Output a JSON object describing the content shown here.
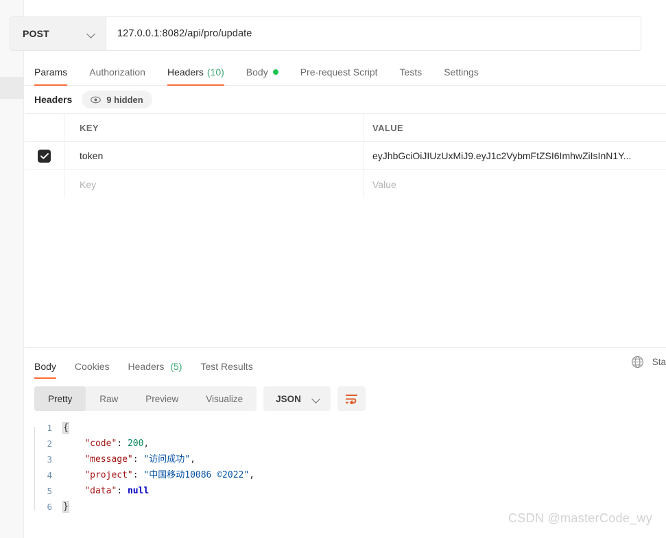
{
  "request": {
    "method": "POST",
    "url": "127.0.0.1:8082/api/pro/update",
    "tabs": [
      {
        "label": "Params",
        "active": false,
        "count": "",
        "dot": false
      },
      {
        "label": "Authorization",
        "active": false,
        "count": "",
        "dot": false
      },
      {
        "label": "Headers",
        "active": true,
        "count": "(10)",
        "dot": false
      },
      {
        "label": "Body",
        "active": false,
        "count": "",
        "dot": true
      },
      {
        "label": "Pre-request Script",
        "active": false,
        "count": "",
        "dot": false
      },
      {
        "label": "Tests",
        "active": false,
        "count": "",
        "dot": false
      },
      {
        "label": "Settings",
        "active": false,
        "count": "",
        "dot": false
      }
    ]
  },
  "headers_panel": {
    "title": "Headers",
    "hidden_badge": "9 hidden",
    "columns": [
      "KEY",
      "VALUE"
    ],
    "rows": [
      {
        "checked": true,
        "key": "token",
        "value": "eyJhbGciOiJIUzUxMiJ9.eyJ1c2VybmFtZSI6ImhwZiIsInN1Y...",
        "placeholder": false
      },
      {
        "checked": false,
        "key": "Key",
        "value": "Value",
        "placeholder": true
      }
    ]
  },
  "response": {
    "tabs": [
      {
        "label": "Body",
        "active": true,
        "count": ""
      },
      {
        "label": "Cookies",
        "active": false,
        "count": ""
      },
      {
        "label": "Headers",
        "active": false,
        "count": "(5)"
      },
      {
        "label": "Test Results",
        "active": false,
        "count": ""
      }
    ],
    "status_text": "Sta",
    "view_modes": [
      "Pretty",
      "Raw",
      "Preview",
      "Visualize"
    ],
    "active_view_mode": "Pretty",
    "format": "JSON",
    "body_lines": [
      {
        "n": "1",
        "segments": [
          {
            "t": "{",
            "c": "brace"
          }
        ]
      },
      {
        "n": "2",
        "segments": [
          {
            "t": "    ",
            "c": "pun"
          },
          {
            "t": "\"code\"",
            "c": "str"
          },
          {
            "t": ": ",
            "c": "pun"
          },
          {
            "t": "200",
            "c": "num"
          },
          {
            "t": ",",
            "c": "pun"
          }
        ]
      },
      {
        "n": "3",
        "segments": [
          {
            "t": "    ",
            "c": "pun"
          },
          {
            "t": "\"message\"",
            "c": "str"
          },
          {
            "t": ": ",
            "c": "pun"
          },
          {
            "t": "\"访问成功\"",
            "c": "val"
          },
          {
            "t": ",",
            "c": "pun"
          }
        ]
      },
      {
        "n": "4",
        "segments": [
          {
            "t": "    ",
            "c": "pun"
          },
          {
            "t": "\"project\"",
            "c": "str"
          },
          {
            "t": ": ",
            "c": "pun"
          },
          {
            "t": "\"中国移动10086 ©2022\"",
            "c": "val"
          },
          {
            "t": ",",
            "c": "pun"
          }
        ]
      },
      {
        "n": "5",
        "segments": [
          {
            "t": "    ",
            "c": "pun"
          },
          {
            "t": "\"data\"",
            "c": "str"
          },
          {
            "t": ": ",
            "c": "pun"
          },
          {
            "t": "null",
            "c": "null"
          }
        ]
      },
      {
        "n": "6",
        "segments": [
          {
            "t": "}",
            "c": "brace"
          }
        ]
      }
    ]
  },
  "watermark": "CSDN @masterCode_wy",
  "colors": {
    "accent": "#ff6c37",
    "count_green": "#3ba776",
    "dot_green": "#1fc352",
    "checkbox": "#2a2a2a",
    "border": "#ededed"
  }
}
